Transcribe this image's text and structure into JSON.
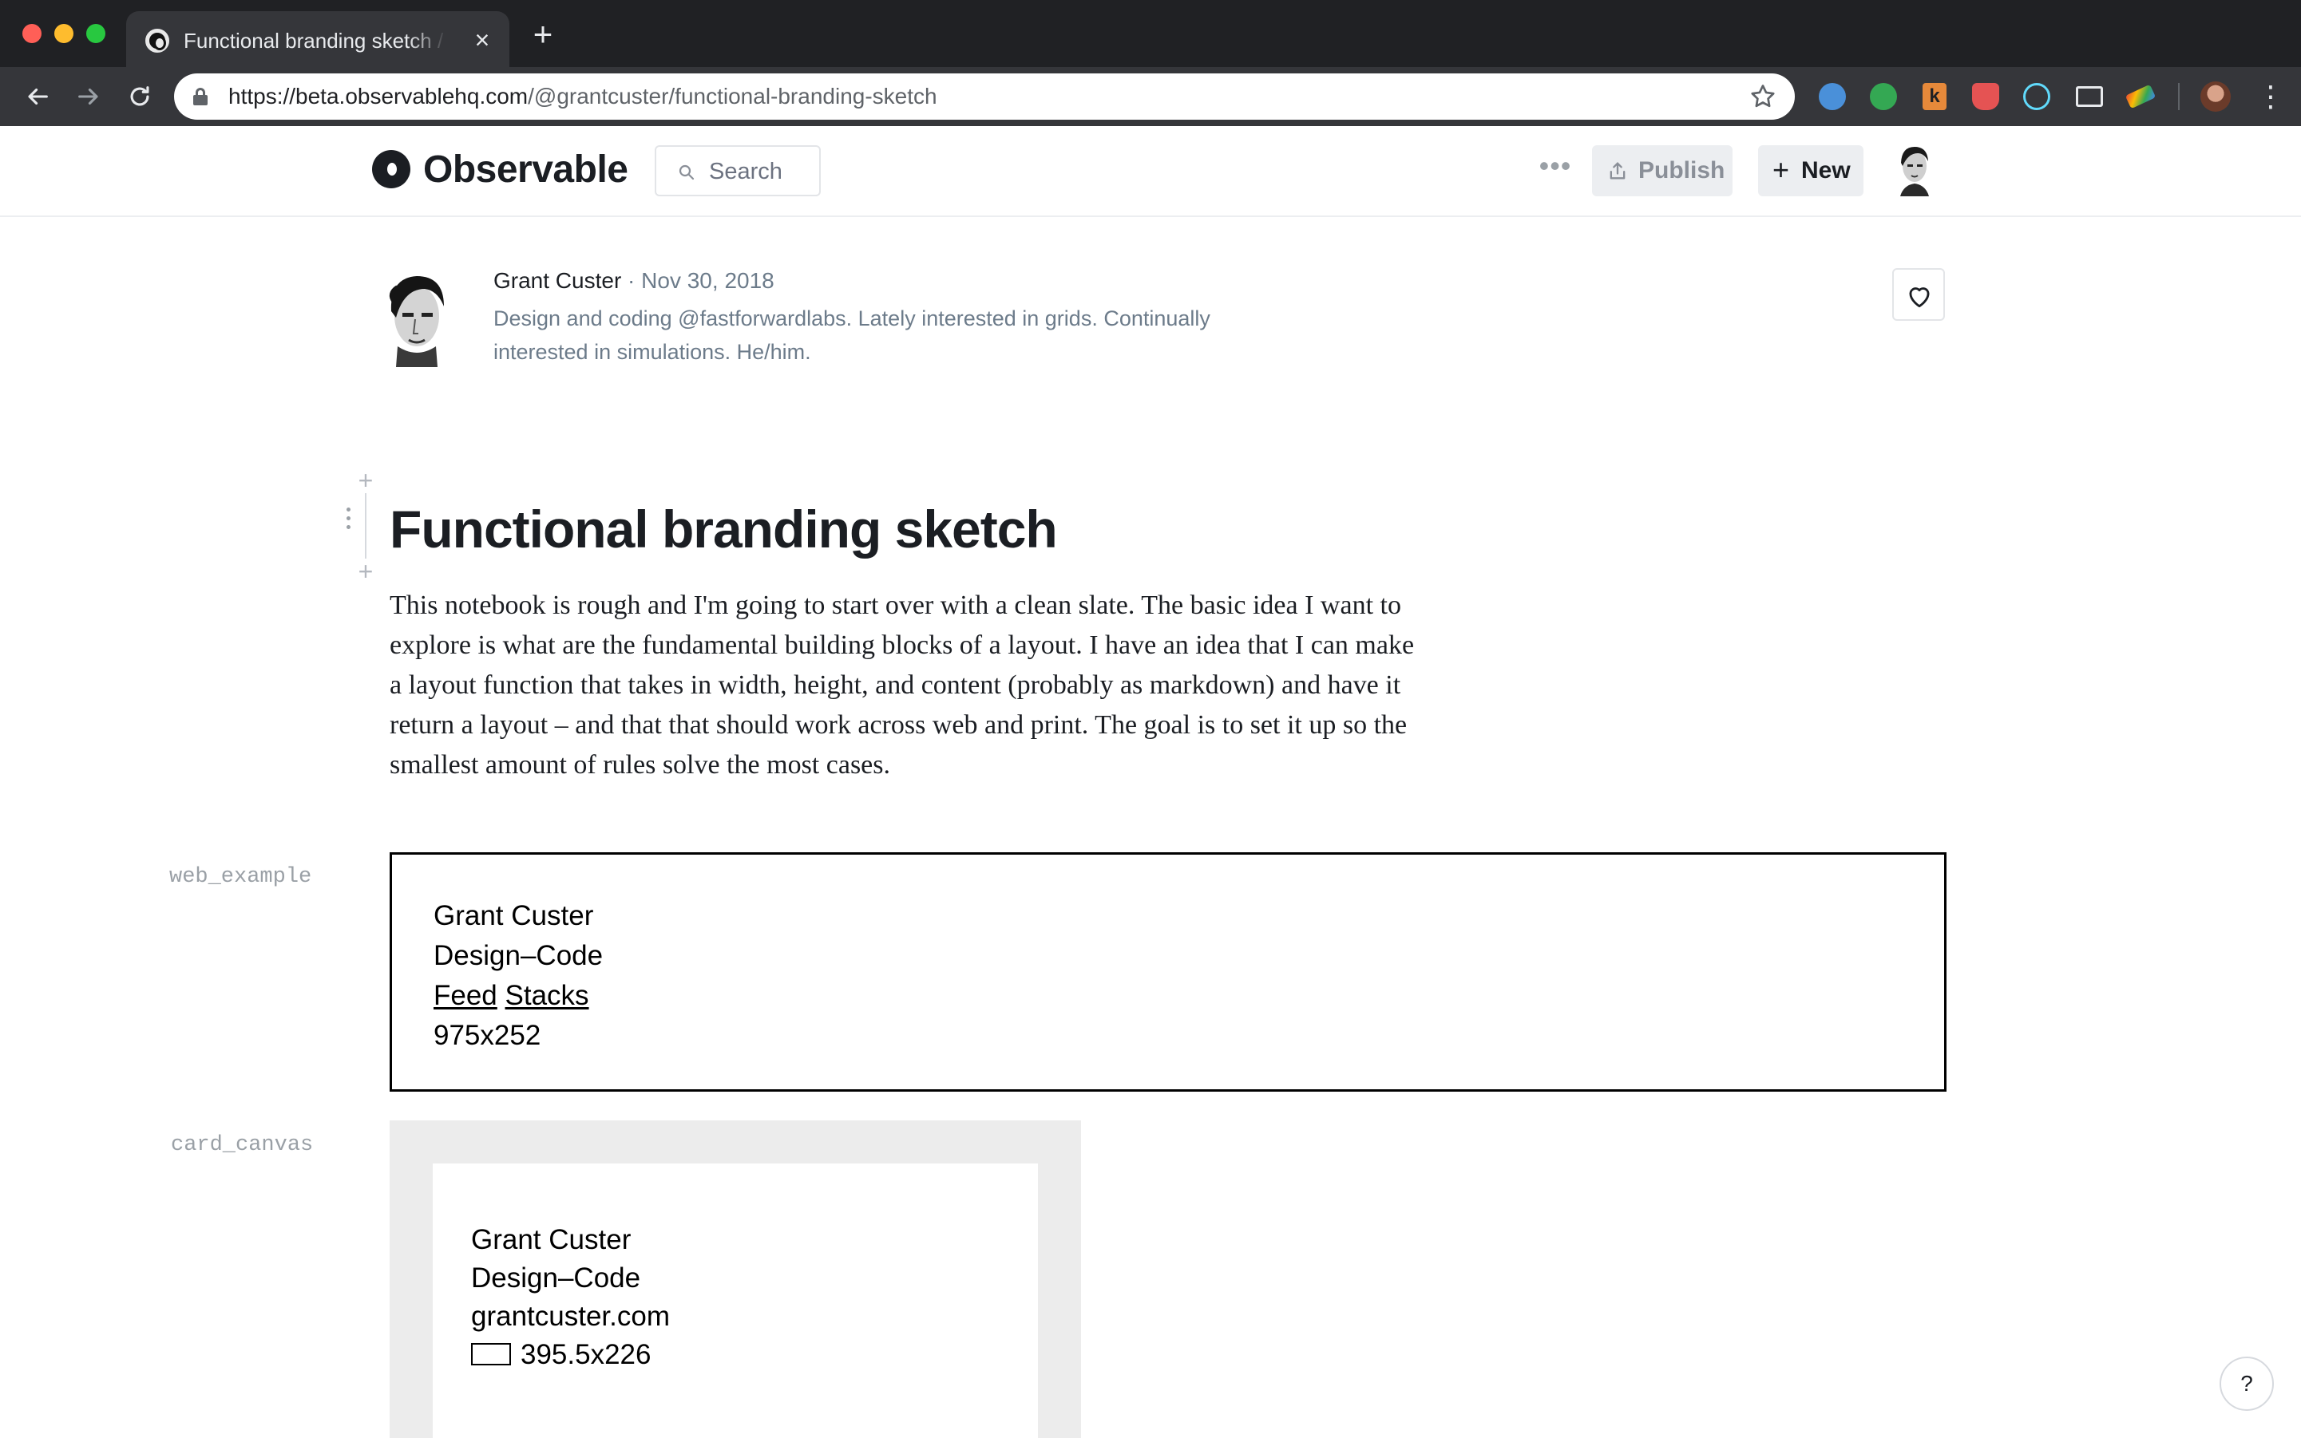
{
  "browser": {
    "tab": {
      "title": "Functional branding sketch / Observable"
    },
    "url": {
      "host": "https://beta.observablehq.com",
      "path": "/@grantcuster/functional-branding-sketch"
    }
  },
  "header": {
    "logo_text": "Observable",
    "search_label": "Search",
    "publish_label": "Publish",
    "new_label": "New"
  },
  "author": {
    "name": "Grant Custer",
    "date": " · Nov 30, 2018",
    "bio": "Design and coding @fastforwardlabs. Lately interested in grids. Continually interested in simulations. He/him."
  },
  "notebook": {
    "title": "Functional branding sketch",
    "intro": "This notebook is rough and I'm going to start over with a clean slate. The basic idea I want to explore is what are the fundamental building blocks of a layout. I have an idea that I can make a layout function that takes in width, height, and content (probably as markdown) and have it return a layout – and that that should work across web and print. The goal is to set it up so the smallest amount of rules solve the most cases."
  },
  "cells": {
    "web_example": {
      "label": "web_example",
      "name": "Grant Custer",
      "tagline": "Design–Code",
      "links": [
        "Feed",
        "Stacks"
      ],
      "size": "975x252"
    },
    "card_canvas": {
      "label": "card_canvas",
      "name": "Grant Custer",
      "tagline": "Design–Code",
      "site": "grantcuster.com",
      "size": "395.5x226"
    }
  },
  "help": {
    "label": "?"
  },
  "icons": {
    "back": "arrow-left-icon",
    "forward": "arrow-right-icon",
    "reload": "reload-icon",
    "lock": "lock-icon",
    "bookmark": "star-icon",
    "search": "search-icon",
    "more": "more-horizontal-icon",
    "publish": "upload-icon",
    "new": "plus-icon",
    "like": "heart-icon"
  },
  "colors": {
    "chrome_bg": "#202124",
    "toolbar_bg": "#35363a",
    "brand_text": "#1b1e23",
    "muted_text": "#6c7b8a",
    "button_bg": "#eceef1"
  }
}
